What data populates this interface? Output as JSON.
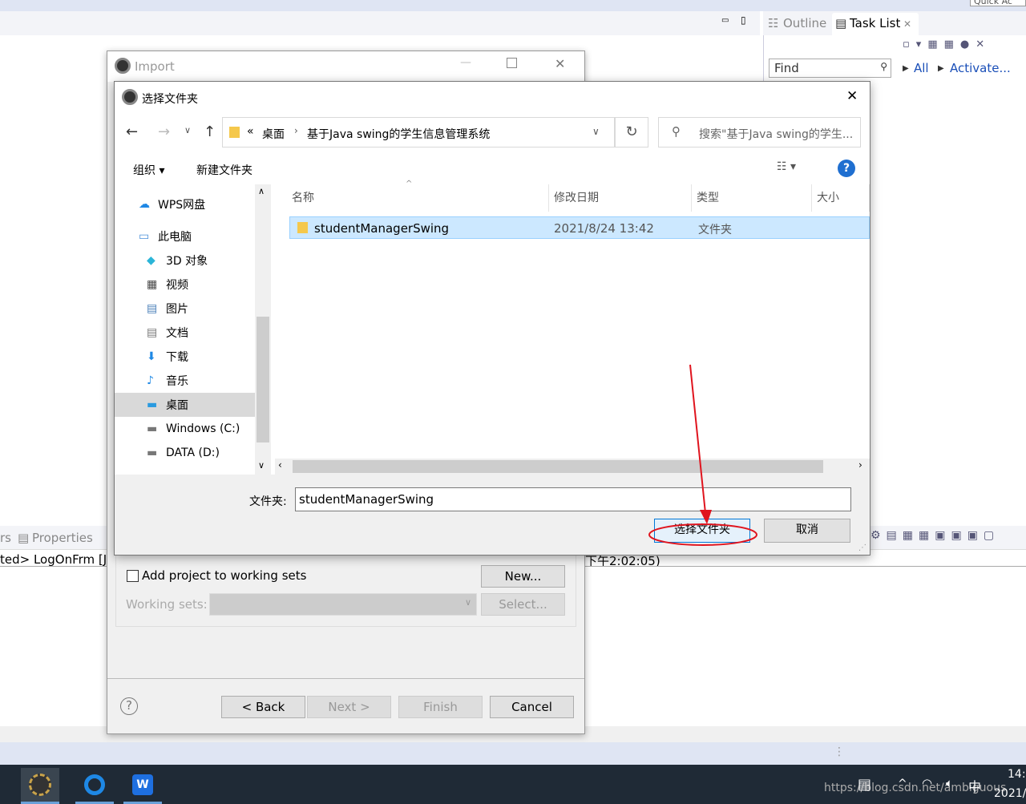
{
  "eclipse": {
    "quick_access": "Quick Ac",
    "right_tabs": [
      {
        "label": "Outline"
      },
      {
        "label": "Task List"
      }
    ],
    "find_placeholder": "Find",
    "links": [
      "All",
      "Activate..."
    ],
    "bottom_tabs": [
      {
        "label": "rs"
      },
      {
        "label": "Properties"
      }
    ],
    "console_line": "ted> LogOnFrm [Ja",
    "console_time": "下午2:02:05)"
  },
  "import_dialog": {
    "title": "Import",
    "add_to_working_sets": "Add project to working sets",
    "add_checked": false,
    "new_button": "New...",
    "working_sets_label": "Working sets:",
    "select_button": "Select...",
    "buttons": {
      "back": "< Back",
      "next": "Next >",
      "finish": "Finish",
      "cancel": "Cancel"
    }
  },
  "chooser": {
    "title": "选择文件夹",
    "breadcrumb": [
      "«",
      "桌面",
      "基于Java swing的学生信息管理系统"
    ],
    "search_placeholder": "搜索\"基于Java swing的学生...",
    "toolbar": {
      "organize": "组织 ▾",
      "new_folder": "新建文件夹"
    },
    "nav": [
      {
        "label": "WPS网盘",
        "icon": "cloud-icon"
      },
      {
        "label": "此电脑",
        "icon": "computer-icon"
      },
      {
        "label": "3D 对象",
        "icon": "cube-icon"
      },
      {
        "label": "视频",
        "icon": "video-icon"
      },
      {
        "label": "图片",
        "icon": "picture-icon"
      },
      {
        "label": "文档",
        "icon": "document-icon"
      },
      {
        "label": "下载",
        "icon": "download-icon"
      },
      {
        "label": "音乐",
        "icon": "music-icon"
      },
      {
        "label": "桌面",
        "icon": "desktop-icon",
        "selected": true
      },
      {
        "label": "Windows (C:)",
        "icon": "drive-icon"
      },
      {
        "label": "DATA (D:)",
        "icon": "drive-icon"
      }
    ],
    "columns": [
      "名称",
      "修改日期",
      "类型",
      "大小"
    ],
    "rows": [
      {
        "name": "studentManagerSwing",
        "date": "2021/8/24 13:42",
        "type": "文件夹",
        "size": ""
      }
    ],
    "folder_label": "文件夹:",
    "folder_value": "studentManagerSwing",
    "ok_button": "选择文件夹",
    "cancel_button": "取消"
  },
  "taskbar": {
    "time": "14:",
    "date": "2021/",
    "ime": "中",
    "watermark": "https://blog.csdn.net/ambiguous"
  },
  "colors": {
    "selection": "#cce8ff",
    "annotation": "#e0141e",
    "link": "#1a4fb8",
    "taskbar": "#1f2a36"
  }
}
